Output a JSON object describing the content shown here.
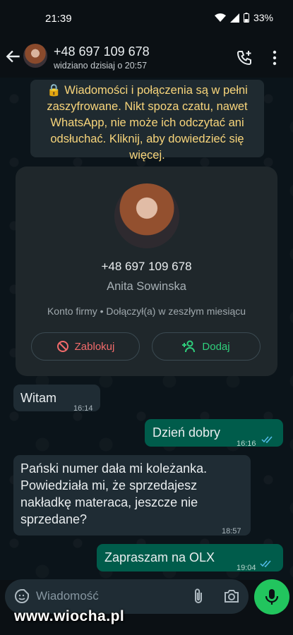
{
  "status": {
    "time": "21:39",
    "battery": "33%"
  },
  "header": {
    "title": "+48 697 109 678",
    "subtitle": "widziano dzisiaj o 20:57"
  },
  "encryption_notice": "🔒 Wiadomości i połączenia są w pełni zaszyfrowane. Nikt spoza czatu, nawet WhatsApp, nie może ich odczytać ani odsłuchać. Kliknij, aby dowiedzieć się więcej.",
  "contact_card": {
    "phone": "+48 697 109 678",
    "name": "Anita Sowinska",
    "meta": "Konto firmy • Dołączył(a) w zeszłym miesiącu",
    "block_label": "Zablokuj",
    "add_label": "Dodaj"
  },
  "messages": [
    {
      "direction": "in",
      "text": "Witam",
      "time": "16:14"
    },
    {
      "direction": "out",
      "text": "Dzień dobry",
      "time": "16:16"
    },
    {
      "direction": "in",
      "text": "Pański numer dała mi koleżanka. Powiedziała mi, że sprzedajesz nakładkę materaca, jeszcze nie sprzedane?",
      "time": "18:57"
    },
    {
      "direction": "out",
      "text": "Zapraszam na OLX",
      "time": "19:04"
    }
  ],
  "composer": {
    "placeholder": "Wiadomość"
  },
  "watermark": "www.wiocha.pl",
  "colors": {
    "accent": "#22c55e",
    "outgoing_bubble": "#005c4b",
    "incoming_bubble": "#1f2c34",
    "danger": "#f26b6b"
  }
}
